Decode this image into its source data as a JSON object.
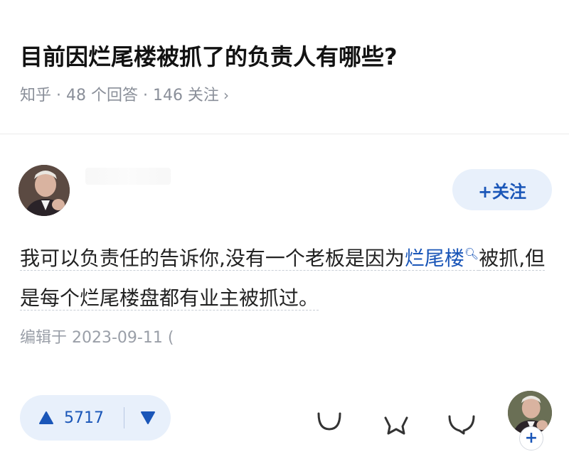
{
  "question": {
    "title": "目前因烂尾楼被抓了的负责人有哪些?",
    "meta": "知乎 · 48 个回答 · 146 关注",
    "meta_chevron": "›"
  },
  "author": {
    "avatar_icon": "person-avatar",
    "follow_label": "+关注"
  },
  "answer": {
    "text_before": "我可以负责任的告诉你,没有一个老板是因为",
    "keyword": "烂尾楼",
    "text_after": "被抓,但是每个烂尾楼盘都有业主被抓过。",
    "edited": "编辑于 2023-09-11 ("
  },
  "toolbar": {
    "upvote_count": "5717",
    "upvote_icon": "triangle-up-icon",
    "downvote_icon": "triangle-down-icon",
    "comment_icon": "comment-icon",
    "favorite_icon": "star-icon",
    "like_icon": "heart-icon",
    "follow_plus": "+"
  },
  "colors": {
    "accent": "#1a56b8",
    "accent_bg": "#e8f0fb",
    "muted": "#8a8f99"
  }
}
